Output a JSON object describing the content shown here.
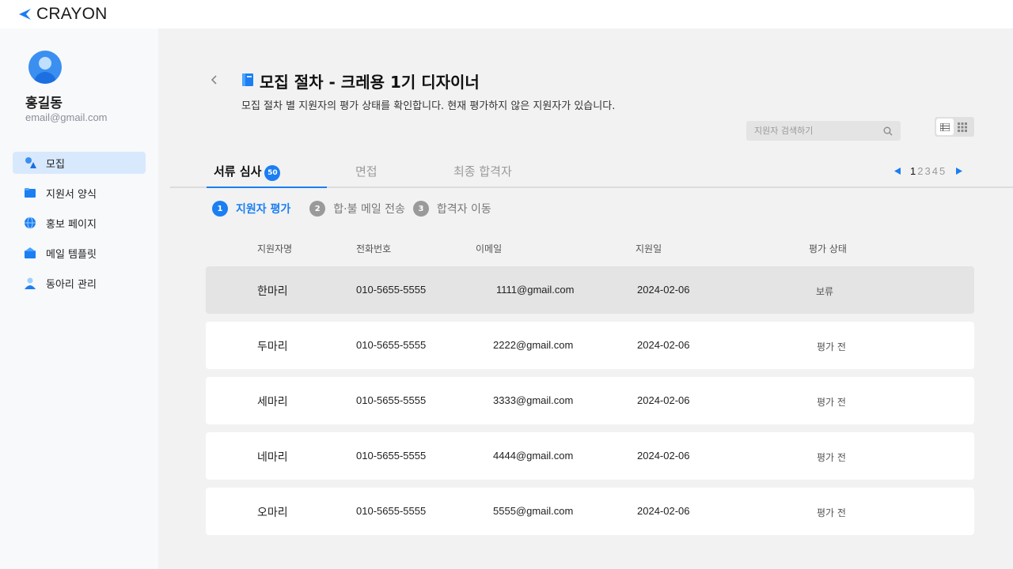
{
  "app": {
    "logo_text": "CRAYON"
  },
  "user": {
    "name": "홍길동",
    "email": "email@gmail.com"
  },
  "sidebar": {
    "items": [
      {
        "label": "모집",
        "icon": "recruit-icon",
        "active": true
      },
      {
        "label": "지원서 양식",
        "icon": "form-folder-icon"
      },
      {
        "label": "홍보 페이지",
        "icon": "globe-icon"
      },
      {
        "label": "메일 템플릿",
        "icon": "mailbox-icon"
      },
      {
        "label": "동아리 관리",
        "icon": "club-person-icon"
      }
    ]
  },
  "header": {
    "title": "모집 절차 - 크레용 1기 디자이너",
    "description": "모집 절차 별 지원자의 평가 상태를 확인합니다. 현재 평가하지 않은 지원자가 있습니다.",
    "search_placeholder": "지원자 검색하기"
  },
  "tabs": [
    {
      "label": "서류 심사",
      "badge": "50",
      "active": true
    },
    {
      "label": "면접"
    },
    {
      "label": "최종 합격자"
    }
  ],
  "pagination": {
    "pages": [
      "1",
      "2",
      "3",
      "4",
      "5"
    ],
    "current": "1"
  },
  "steps": [
    {
      "num": "1",
      "label": "지원자 평가",
      "active": true
    },
    {
      "num": "2",
      "label": "합·불 메일 전송"
    },
    {
      "num": "3",
      "label": "합격자 이동"
    }
  ],
  "table": {
    "columns": [
      "지원자명",
      "전화번호",
      "이메일",
      "지원일",
      "평가 상태"
    ],
    "rows": [
      {
        "name": "한마리",
        "phone": "010-5655-5555",
        "email": "1111@gmail.com",
        "date": "2024-02-06",
        "status": "보류",
        "selected": true
      },
      {
        "name": "두마리",
        "phone": "010-5655-5555",
        "email": "2222@gmail.com",
        "date": "2024-02-06",
        "status": "평가 전"
      },
      {
        "name": "세마리",
        "phone": "010-5655-5555",
        "email": "3333@gmail.com",
        "date": "2024-02-06",
        "status": "평가 전"
      },
      {
        "name": "네마리",
        "phone": "010-5655-5555",
        "email": "4444@gmail.com",
        "date": "2024-02-06",
        "status": "평가 전"
      },
      {
        "name": "오마리",
        "phone": "010-5655-5555",
        "email": "5555@gmail.com",
        "date": "2024-02-06",
        "status": "평가 전"
      }
    ]
  },
  "colors": {
    "accent": "#1b7ef2",
    "selected_row": "#e4e4e4",
    "nav_active": "#d8e9fd"
  }
}
